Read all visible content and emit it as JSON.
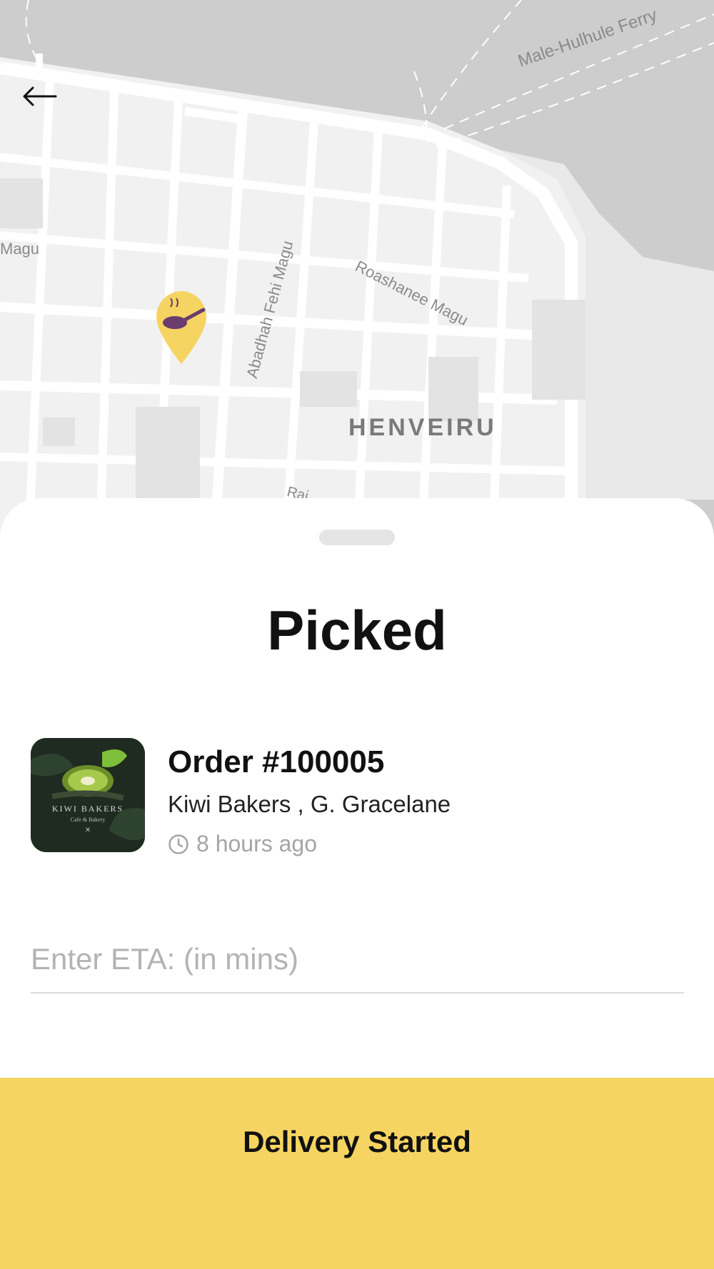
{
  "map": {
    "labels": {
      "ferry": "Male-Hulhule Ferry",
      "magu_left": "Magu",
      "abadhah": "Abadhah Fehi Magu",
      "roashanee": "Roashanee Magu",
      "district": "HENVEIRU",
      "road_partial": "Rai"
    },
    "pin_icon": "frying-pan-icon",
    "pin_color": "#f5d462"
  },
  "nav": {
    "back_icon": "arrow-left-icon"
  },
  "sheet": {
    "title": "Picked",
    "order": {
      "number": "Order #100005",
      "restaurant": "Kiwi Bakers , G. Gracelane",
      "time": "8 hours ago",
      "thumbnail_text": "KIWI BAKERS",
      "thumbnail_subtext": "Cafe & Bakery"
    },
    "eta": {
      "placeholder": "Enter ETA: (in mins)",
      "value": ""
    },
    "action": {
      "label": "Delivery Started",
      "color": "#f5d462"
    }
  }
}
